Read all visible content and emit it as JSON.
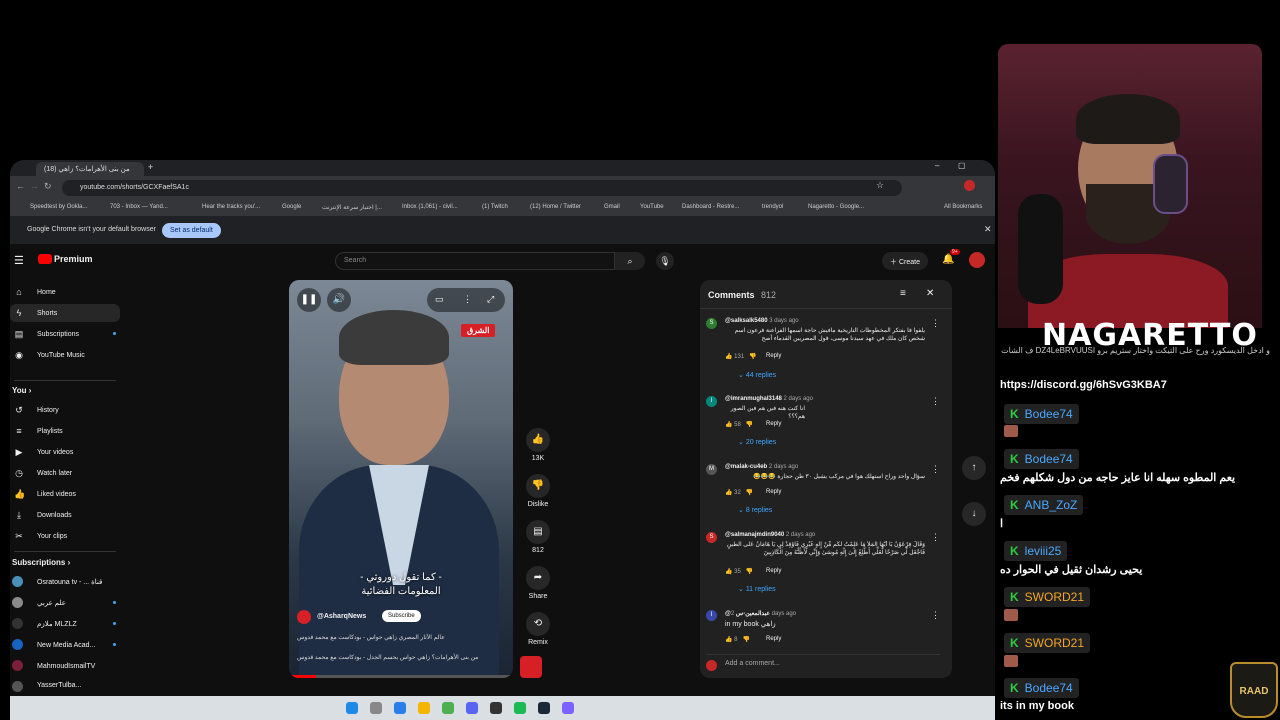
{
  "browser": {
    "tab_title": "(18) من بنى الأهرامات؟ زاهي",
    "url": "youtube.com/shorts/GCXFaefSA1c",
    "bookmarks": [
      "Speedtest by Ookla...",
      "703 - Inbox — Yand...",
      "Hear the tracks you'...",
      "Google",
      "اختبار سرعة الإنترنت |...",
      "Inbox (1,061) - civil...",
      "(1) Twitch",
      "(12) Home / Twitter",
      "Gmail",
      "YouTube",
      "Dashboard - Restre...",
      "trendyol",
      "Nagaretto - Google..."
    ],
    "all_bookmarks": "All Bookmarks",
    "infobar_text": "Google Chrome isn't your default browser",
    "set_default": "Set as default"
  },
  "youtube": {
    "logo": "Premium",
    "search_placeholder": "Search",
    "create": "Create",
    "notif_count": "9+",
    "sidebar": {
      "main": [
        {
          "label": "Home",
          "icon": "home-icon"
        },
        {
          "label": "Shorts",
          "icon": "shorts-icon"
        },
        {
          "label": "Subscriptions",
          "icon": "subscriptions-icon"
        },
        {
          "label": "YouTube Music",
          "icon": "music-icon"
        }
      ],
      "you_heading": "You",
      "you": [
        {
          "label": "History",
          "icon": "history-icon"
        },
        {
          "label": "Playlists",
          "icon": "playlists-icon"
        },
        {
          "label": "Your videos",
          "icon": "video-icon"
        },
        {
          "label": "Watch later",
          "icon": "clock-icon"
        },
        {
          "label": "Liked videos",
          "icon": "like-icon"
        },
        {
          "label": "Downloads",
          "icon": "download-icon"
        },
        {
          "label": "Your clips",
          "icon": "scissors-icon"
        }
      ],
      "subs_heading": "Subscriptions",
      "subs": [
        "Osratouna tv - ... قناة",
        "علم عربي",
        "ملازم MLZLZ",
        "New Media Acad...",
        "MahmoudIsmailTV",
        "YasserTulba..."
      ]
    },
    "short": {
      "brand": "الشرق",
      "subtitle_line1": "- كما تقول دوروثي -",
      "subtitle_line2": "المعلومات الفضائية",
      "channel": "@AsharqNews",
      "subscribe": "Subscribe",
      "line1": "عالم الآثار المصري زاهي حواس - بودكاست مع محمد قدوس",
      "line2": "من بنى الأهرامات؟ زاهي حواس يحسم الجدل - بودكاست مع محمد قدوس",
      "progress": 0.12
    },
    "actions": [
      {
        "label": "13K",
        "icon": "thumbs-up-icon"
      },
      {
        "label": "Dislike",
        "icon": "thumbs-down-icon"
      },
      {
        "label": "812",
        "icon": "comment-icon"
      },
      {
        "label": "Share",
        "icon": "share-icon"
      },
      {
        "label": "Remix",
        "icon": "remix-icon"
      }
    ],
    "comments": {
      "title": "Comments",
      "count": "812",
      "items": [
        {
          "user": "@salksalk5480",
          "time": "3 days ago",
          "text": "يلفوا فا بفتكر المخطوطات التاريخية مافيش حاجة اسمها الفراعنة فرعون اسم شخص كان ملك في عهد سيدنا موسى، قول المصريين القدماء أصح",
          "likes": "131",
          "replies": "44 replies",
          "avatar": "S",
          "color": "#2e7d32"
        },
        {
          "user": "@imranmughal3148",
          "time": "2 days ago",
          "text": "انا كنت هنه فين هم فين الصور هم؟؟؟",
          "likes": "58",
          "replies": "20 replies",
          "avatar": "I",
          "color": "#00897b"
        },
        {
          "user": "@malak-cu4eb",
          "time": "2 days ago",
          "text": "سؤال واحد وراح استهلك هوا في مركب يشيل ٣٠ طن حجارة 😂😂😂",
          "likes": "32",
          "replies": "8 replies",
          "avatar": "M",
          "color": "#555555"
        },
        {
          "user": "@salmanajmdin9040",
          "time": "2 days ago",
          "text": "وَقَالَ فِرْعَوْنُ يَا أَيُّهَا الْمَلَأُ مَا عَلِمْتُ لَكُم مِّنْ إِلَٰهٍ غَيْرِي فَأَوْقِدْ لِي يَا هَامَانُ عَلَى الطِّينِ فَاجْعَل لِّي صَرْحًا لَّعَلِّي أَطَّلِعُ إِلَىٰ إِلَٰهِ مُوسَىٰ وَإِنِّي لَأَظُنُّهُ مِنَ الْكَاذِبِينَ",
          "likes": "35",
          "replies": "11 replies",
          "avatar": "S",
          "color": "#c62828"
        },
        {
          "user": "@عبدالمعين-س",
          "time": "2 days ago",
          "text": "in my book زاهي",
          "likes": "8",
          "replies": "",
          "avatar": "I",
          "color": "#3949ab"
        }
      ],
      "reply_label": "Reply",
      "add_placeholder": "Add a comment..."
    }
  },
  "stream": {
    "streamer": "NAGARETTO",
    "chat_top1": "و ادخل الديسكورد ورح على التيكت واختار ستريم برو DZ4LeBRVUUSI ف الشات ايه دا انت لايف يتجاهل 😊",
    "discord": "https://discord.gg/6hSvG3KBA7",
    "messages": [
      {
        "user": "Bodee74",
        "text": "",
        "emote": true,
        "gold": false
      },
      {
        "user": "Bodee74",
        "text": "يعم المطوه سهله انا عايز حاجه من دول شكلهم فخم",
        "emote": false,
        "gold": false
      },
      {
        "user": "ANB_ZoZ",
        "text": "ا",
        "emote": false,
        "gold": false
      },
      {
        "user": "leviii25",
        "text": "يحيى رشدان ثقيل في الحوار ده",
        "emote": false,
        "gold": false
      },
      {
        "user": "SWORD21",
        "text": "",
        "emote": true,
        "gold": true
      },
      {
        "user": "SWORD21",
        "text": "",
        "emote": true,
        "gold": true
      },
      {
        "user": "Bodee74",
        "text": "its in my book",
        "emote": false,
        "gold": false
      }
    ],
    "badge": "RAAD"
  }
}
